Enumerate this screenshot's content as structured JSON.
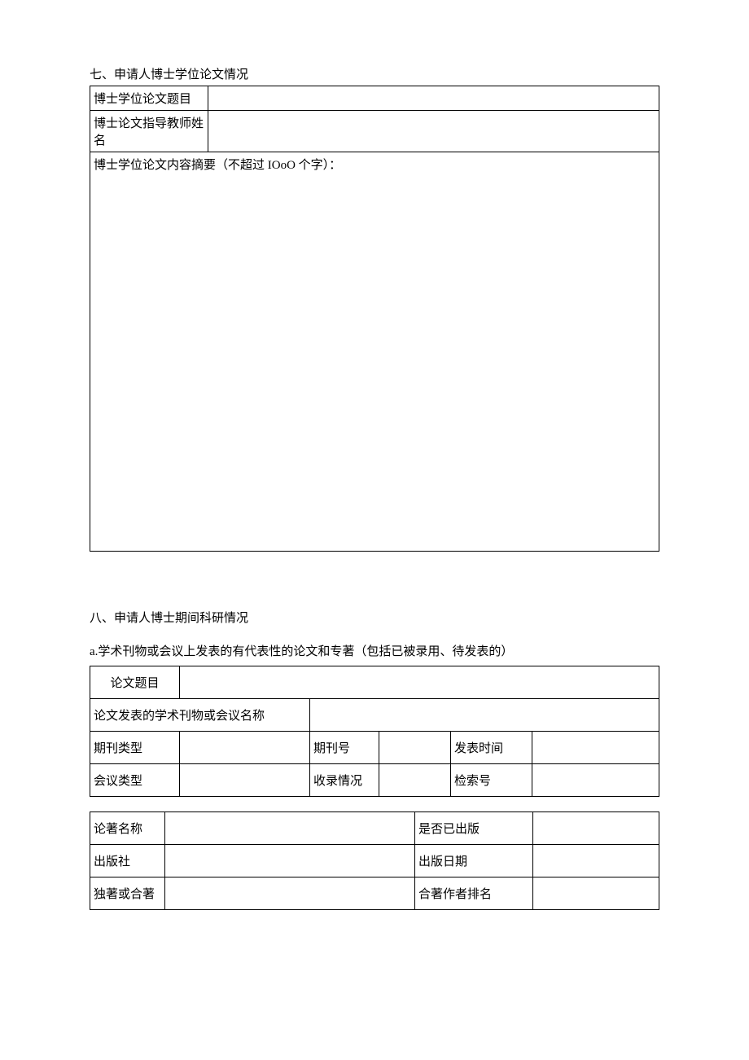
{
  "section7": {
    "title": "七、申请人博士学位论文情况",
    "row1_label": "博士学位论文题目",
    "row1_value": "",
    "row2_label": "博士论文指导教师姓名",
    "row2_value": "",
    "abstract_label": "博士学位论文内容摘要（不超过 IOoO 个字）：",
    "abstract_value": ""
  },
  "section8": {
    "title": "八、申请人博士期间科研情况",
    "subtitle_a": "a.学术刊物或会议上发表的有代表性的论文和专著（包括已被录用、待发表的）",
    "table_a": {
      "paper_title_label": "论文题目",
      "paper_title_value": "",
      "journal_name_label": "论文发表的学术刊物或会议名称",
      "journal_name_value": "",
      "journal_type_label": "期刊类型",
      "journal_type_value": "",
      "journal_no_label": "期刊号",
      "journal_no_value": "",
      "publish_time_label": "发表时间",
      "publish_time_value": "",
      "conf_type_label": "会议类型",
      "conf_type_value": "",
      "inclusion_label": "收录情况",
      "inclusion_value": "",
      "index_no_label": "检索号",
      "index_no_value": ""
    },
    "table_b": {
      "book_name_label": "论著名称",
      "book_name_value": "",
      "is_published_label": "是否已出版",
      "is_published_value": "",
      "publisher_label": "出版社",
      "publisher_value": "",
      "publish_date_label": "出版日期",
      "publish_date_value": "",
      "author_type_label": "独著或合著",
      "author_type_value": "",
      "coauthor_rank_label": "合著作者排名",
      "coauthor_rank_value": ""
    }
  }
}
